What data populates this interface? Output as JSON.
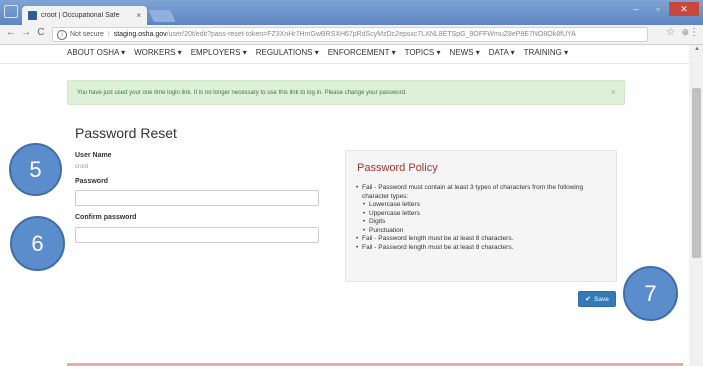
{
  "browser": {
    "tab_title": "croot | Occupational Safe",
    "tab_close": "×",
    "window_buttons": [
      "–",
      "▫",
      "✕"
    ],
    "nav": {
      "back": "←",
      "forward": "→",
      "reload": "C"
    },
    "address": {
      "info_glyph": "i",
      "not_secure": "Not secure",
      "separator": "|",
      "host": "staging.osha.gov",
      "path": "/user/20t/edit?pass-reset-token=FZ3XnHr7HmGwBRSXH67pRdScyMzDc2epsxc7LXNL8ETSpG_9OFFWmuZ8eP8E7NO8Ok8fUYA"
    },
    "star": "☆",
    "extension": "⊕",
    "menu": "⋮"
  },
  "site_nav": [
    "ABOUT OSHA ▾",
    "WORKERS ▾",
    "EMPLOYERS ▾",
    "REGULATIONS ▾",
    "ENFORCEMENT ▾",
    "TOPICS ▾",
    "NEWS ▾",
    "DATA ▾",
    "TRAINING ▾"
  ],
  "alert": {
    "message": "You have just used your one time login link. It is no longer necessary to use this link to log in. Please change your password.",
    "close": "×"
  },
  "form": {
    "title": "Password Reset",
    "username_label": "User Name",
    "username_value": "croot",
    "password_label": "Password",
    "password_value": "",
    "confirm_label": "Confirm password",
    "confirm_value": ""
  },
  "policy": {
    "title": "Password Policy",
    "items": [
      {
        "text": "Fail - Password must contain at least 3 types of characters from the following character types:",
        "level": 0
      },
      {
        "text": "Lowercase letters",
        "level": 1
      },
      {
        "text": "Uppercase letters",
        "level": 1
      },
      {
        "text": "Digits",
        "level": 1
      },
      {
        "text": "Punctuation",
        "level": 1
      },
      {
        "text": "Fail - Password length must be at least 8 characters.",
        "level": 0
      },
      {
        "text": "Fail - Password length must be at least 8 characters.",
        "level": 0
      }
    ]
  },
  "save_button": {
    "label": "Save",
    "icon": "✔"
  },
  "callouts": [
    "5",
    "6",
    "7"
  ],
  "colors": {
    "callout_fill": "#5b8ccc",
    "alert_bg": "#dff0d8",
    "primary": "#337ab7",
    "policy_title": "#a5352d"
  }
}
